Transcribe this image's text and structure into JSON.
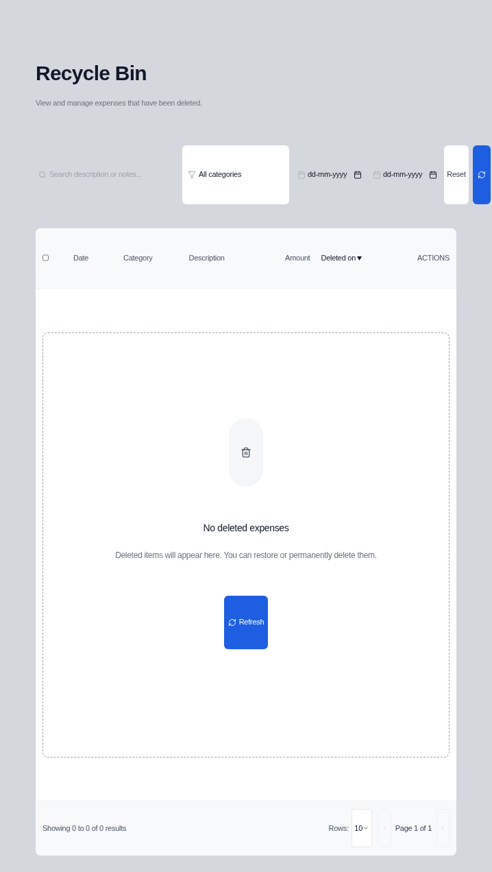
{
  "header": {
    "title": "Recycle Bin",
    "subtitle": "View and manage expenses that have been deleted."
  },
  "filters": {
    "search": {
      "placeholder": "Search description or notes..."
    },
    "category": {
      "value": "All categories"
    },
    "dates": [
      {
        "placeholder": "dd-mm-yyyy"
      },
      {
        "placeholder": "dd-mm-yyyy"
      }
    ],
    "reset": "Reset"
  },
  "table": {
    "select_all": {
      "checked": false
    },
    "columns": [
      {
        "label": "Date",
        "sorted": false
      },
      {
        "label": "Category",
        "sorted": false
      },
      {
        "label": "Description",
        "sorted": false
      },
      {
        "label": "Amount",
        "sorted": false
      },
      {
        "label": "Deleted on",
        "sorted": true
      },
      {
        "label": "ACTIONS",
        "sorted": false
      }
    ],
    "empty_state": {
      "title": "No deleted expenses",
      "message": "Deleted items will appear here. You can restore or permanently delete them.",
      "button": "Refresh"
    },
    "footer": {
      "summary": "Showing 0 to 0 of 0 results",
      "rows_label": "Rows:",
      "rows_value": "10",
      "page": "Page 1 of 1"
    }
  }
}
